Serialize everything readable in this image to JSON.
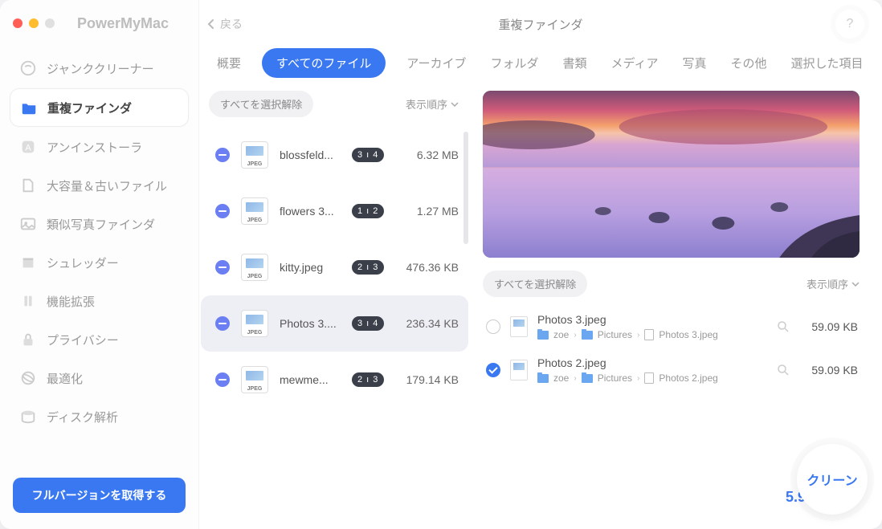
{
  "app": {
    "name": "PowerMyMac",
    "back_label": "戻る",
    "page_title": "重複ファインダ",
    "help_symbol": "?"
  },
  "sidebar": {
    "items": [
      {
        "label": "ジャンククリーナー"
      },
      {
        "label": "重複ファインダ"
      },
      {
        "label": "アンインストーラ"
      },
      {
        "label": "大容量＆古いファイル"
      },
      {
        "label": "類似写真ファインダ"
      },
      {
        "label": "シュレッダー"
      },
      {
        "label": "機能拡張"
      },
      {
        "label": "プライバシー"
      },
      {
        "label": "最適化"
      },
      {
        "label": "ディスク解析"
      }
    ],
    "upgrade_label": "フルバージョンを取得する"
  },
  "tabs": {
    "items": [
      {
        "label": "概要"
      },
      {
        "label": "すべてのファイル"
      },
      {
        "label": "アーカイブ"
      },
      {
        "label": "フォルダ"
      },
      {
        "label": "書類"
      },
      {
        "label": "メディア"
      },
      {
        "label": "写真"
      },
      {
        "label": "その他"
      },
      {
        "label": "選択した項目"
      }
    ],
    "active_index": 1
  },
  "left": {
    "deselect_all": "すべてを選択解除",
    "sort_label": "表示順序",
    "groups": [
      {
        "name": "blossfeld...",
        "badge": "3 ı 4",
        "size": "6.32 MB",
        "ext": "JPEG"
      },
      {
        "name": "flowers 3...",
        "badge": "1 ı 2",
        "size": "1.27 MB",
        "ext": "JPEG"
      },
      {
        "name": "kitty.jpeg",
        "badge": "2 ı 3",
        "size": "476.36 KB",
        "ext": "JPEG"
      },
      {
        "name": "Photos 3....",
        "badge": "3 ı 4",
        "size": "236.34 KB",
        "ext": "JPEG"
      },
      {
        "name": "mewme...",
        "badge": "2 ı 3",
        "size": "179.14 KB",
        "ext": "JPEG"
      }
    ],
    "selected_index": 3
  },
  "right": {
    "deselect_all": "すべてを選択解除",
    "sort_label": "表示順序",
    "files": [
      {
        "name": "Photos 3.jpeg",
        "checked": false,
        "size": "59.09 KB",
        "path": [
          {
            "t": "folder",
            "v": "zoe"
          },
          {
            "t": "folder",
            "v": "Pictures"
          },
          {
            "t": "file",
            "v": "Photos 3.jpeg"
          }
        ]
      },
      {
        "name": "Photos 2.jpeg",
        "checked": true,
        "size": "59.09 KB",
        "path": [
          {
            "t": "folder",
            "v": "zoe"
          },
          {
            "t": "folder",
            "v": "Pictures"
          },
          {
            "t": "file",
            "v": "Photos 2.jpeg"
          }
        ]
      }
    ]
  },
  "footer": {
    "total": "5.98 MB",
    "clean_label": "クリーン"
  }
}
